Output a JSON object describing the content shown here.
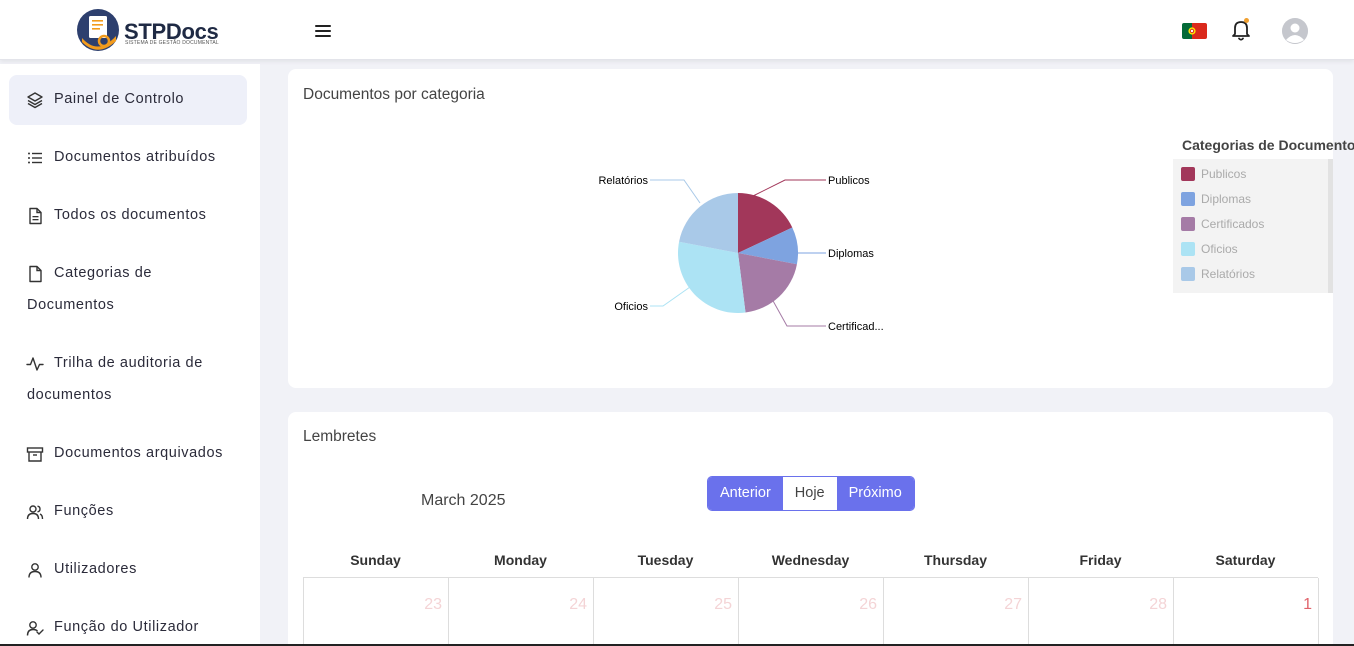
{
  "app": {
    "name": "STPDocs",
    "subtitle": "SISTEMA DE GESTÃO DOCUMENTAL"
  },
  "header": {
    "menu_icon": "hamburger-icon",
    "language_flag": "portugal-flag",
    "notification_icon": "bell-icon",
    "user_icon": "avatar-icon"
  },
  "sidebar": {
    "items": [
      {
        "label": "Painel de Controlo",
        "icon": "layers-icon",
        "active": true
      },
      {
        "label": "Documentos atribuídos",
        "icon": "list-icon"
      },
      {
        "label": "Todos os documentos",
        "icon": "file-text-icon"
      },
      {
        "label": "Categorias de",
        "label2": "Documentos",
        "icon": "file-icon"
      },
      {
        "label": "Trilha de auditoria de",
        "label2": "documentos",
        "icon": "activity-icon"
      },
      {
        "label": "Documentos arquivados",
        "icon": "archive-icon"
      },
      {
        "label": "Funções",
        "icon": "users-icon"
      },
      {
        "label": "Utilizadores",
        "icon": "user-icon"
      },
      {
        "label": "Função do Utilizador",
        "icon": "user-check-icon"
      }
    ]
  },
  "category_card": {
    "title": "Documentos por categoria",
    "legend_title": "Categorias de Documentos",
    "labels": {
      "publicos": "Publicos",
      "diplomas": "Diplomas",
      "certificados": "Certificad...",
      "oficios": "Oficios",
      "relatorios": "Relatórios"
    }
  },
  "chart_data": {
    "type": "pie",
    "categories": [
      "Publicos",
      "Diplomas",
      "Certificados",
      "Oficios",
      "Relatórios"
    ],
    "values": [
      18,
      10,
      20,
      30,
      22
    ],
    "colors": [
      "#a2375a",
      "#7ea3e0",
      "#a57ba6",
      "#ace3f4",
      "#a9c9e8"
    ],
    "legend_title": "Categorias de Documentos",
    "legend_placement": "right"
  },
  "reminders": {
    "title": "Lembretes",
    "month": "March 2025",
    "buttons": {
      "prev": "Anterior",
      "today": "Hoje",
      "next": "Próximo"
    },
    "weekdays": [
      "Sunday",
      "Monday",
      "Tuesday",
      "Wednesday",
      "Thursday",
      "Friday",
      "Saturday"
    ],
    "first_week": [
      "23",
      "24",
      "25",
      "26",
      "27",
      "28",
      "1"
    ]
  }
}
